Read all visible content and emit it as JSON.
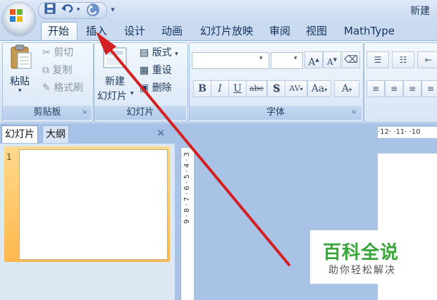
{
  "title": "新建",
  "quick_access": {
    "save_icon": "save-icon",
    "undo_icon": "undo-icon",
    "redo_icon": "redo-icon",
    "customize_icon": "customize-icon"
  },
  "tabs": [
    "开始",
    "插入",
    "设计",
    "动画",
    "幻灯片放映",
    "审阅",
    "视图",
    "MathType"
  ],
  "active_tab": "开始",
  "clipboard": {
    "paste": "粘贴",
    "cut": "剪切",
    "copy": "复制",
    "format_painter": "格式刷",
    "label": "剪贴板"
  },
  "slides": {
    "new_slide_line1": "新建",
    "new_slide_line2": "幻灯片",
    "layout": "版式",
    "reset": "重设",
    "delete": "删除",
    "label": "幻灯片"
  },
  "font": {
    "label": "字体",
    "bold": "B",
    "italic": "I",
    "underline": "U",
    "strikethrough": "abe",
    "shadow": "S",
    "spacing": "AV",
    "change_case": "Aa",
    "font_color": "A",
    "grow": "A",
    "shrink": "A"
  },
  "panes": {
    "slides_tab": "幻灯片",
    "outline_tab": "大纲",
    "close": "✕",
    "slide_number": "1"
  },
  "ruler": {
    "horizontal": "·12·  ·11·  ·10",
    "vertical": "9 · 8 · 7 · 6 · 5 · 4 · 3"
  },
  "watermark": {
    "title": "百科全说",
    "subtitle": "助你轻松解决"
  },
  "colors": {
    "accent_arrow": "#d42020",
    "watermark_green": "#3aa53a",
    "selection": "#ffb84d"
  }
}
